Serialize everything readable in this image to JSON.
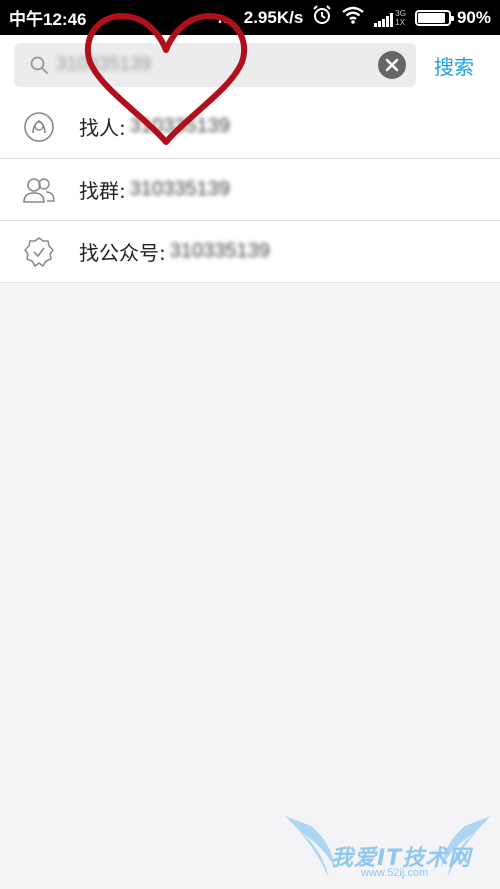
{
  "status_bar": {
    "time": "中午12:46",
    "dots": "...",
    "network_speed": "2.95K/s",
    "alarm_icon": "alarm-clock-icon",
    "wifi_icon": "wifi-icon",
    "network_type_top": "3G",
    "network_type_bottom": "1X",
    "battery_percent": "90%",
    "battery_level": 0.9
  },
  "search": {
    "icon": "search-icon",
    "value": "310335139",
    "clear_icon": "clear-icon",
    "search_button_label": "搜索"
  },
  "results": [
    {
      "icon": "person-icon",
      "label": "找人:",
      "value": "310335139"
    },
    {
      "icon": "group-icon",
      "label": "找群:",
      "value": "310335139"
    },
    {
      "icon": "verified-badge-icon",
      "label": "找公众号:",
      "value": "310335139"
    }
  ],
  "overlay": {
    "heart_color": "#b0101a"
  },
  "watermark": {
    "text": "我爱IT技术网",
    "url": "www.52ij.com"
  }
}
